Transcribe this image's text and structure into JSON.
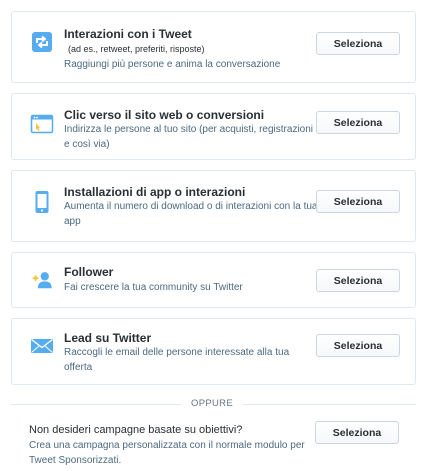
{
  "options": [
    {
      "title": "Interazioni con i Tweet",
      "subtitle": "(ad es., retweet, preferiti, risposte)",
      "description": "Raggiungi più persone e anima la conversazione",
      "button": "Seleziona",
      "icon": "retweet-icon"
    },
    {
      "title": "Clic verso il sito web o conversioni",
      "description": "Indirizza le persone al tuo sito (per acquisti, registrazioni e così via)",
      "button": "Seleziona",
      "icon": "browser-window-icon"
    },
    {
      "title": "Installazioni di app o interazioni",
      "description": "Aumenta il numero di download o di interazioni con la tua app",
      "button": "Seleziona",
      "icon": "mobile-phone-icon"
    },
    {
      "title": "Follower",
      "description": "Fai crescere la tua community su Twitter",
      "button": "Seleziona",
      "icon": "add-follower-icon"
    },
    {
      "title": "Lead su Twitter",
      "description": "Raccogli le email delle persone interessate alla tua offerta",
      "button": "Seleziona",
      "icon": "envelope-icon"
    }
  ],
  "divider_label": "OPPURE",
  "custom": {
    "title": "Non desideri campagne basate su obiettivi?",
    "description": "Crea una campagna personalizzata con il normale modulo per Tweet Sponsorizzati.",
    "button": "Seleziona"
  },
  "colors": {
    "icon_blue": "#55acee",
    "icon_gold": "#f5c33a",
    "border": "#e1e8ed",
    "text": "#292f33",
    "muted": "#4c6a80"
  }
}
